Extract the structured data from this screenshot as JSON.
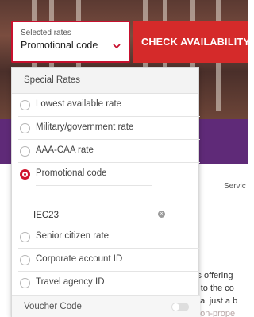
{
  "rate_selector": {
    "label": "Selected rates",
    "value": "Promotional code"
  },
  "cta": {
    "label": "CHECK AVAILABILITY"
  },
  "dropdown": {
    "header": "Special Rates",
    "options": [
      {
        "label": "Lowest available rate",
        "selected": false
      },
      {
        "label": "Military/government rate",
        "selected": false
      },
      {
        "label": "AAA-CAA rate",
        "selected": false
      },
      {
        "label": "Promotional code",
        "selected": true
      },
      {
        "label": "Senior citizen rate",
        "selected": false
      },
      {
        "label": "Corporate account ID",
        "selected": false
      },
      {
        "label": "Travel agency ID",
        "selected": false
      }
    ],
    "promo_code_value": "IEC23",
    "voucher": {
      "label": "Voucher Code",
      "enabled": false
    }
  },
  "background": {
    "service_text": "Servic",
    "body_lines": [
      "is offering",
      "r to the co",
      "dal just a b",
      "f on-prope"
    ]
  },
  "colors": {
    "accent_red": "#d52a2a",
    "brand_purple": "#5f2a78"
  },
  "icons": {
    "select_chevron": "chevron-down-icon",
    "clear_input": "clear-icon"
  }
}
